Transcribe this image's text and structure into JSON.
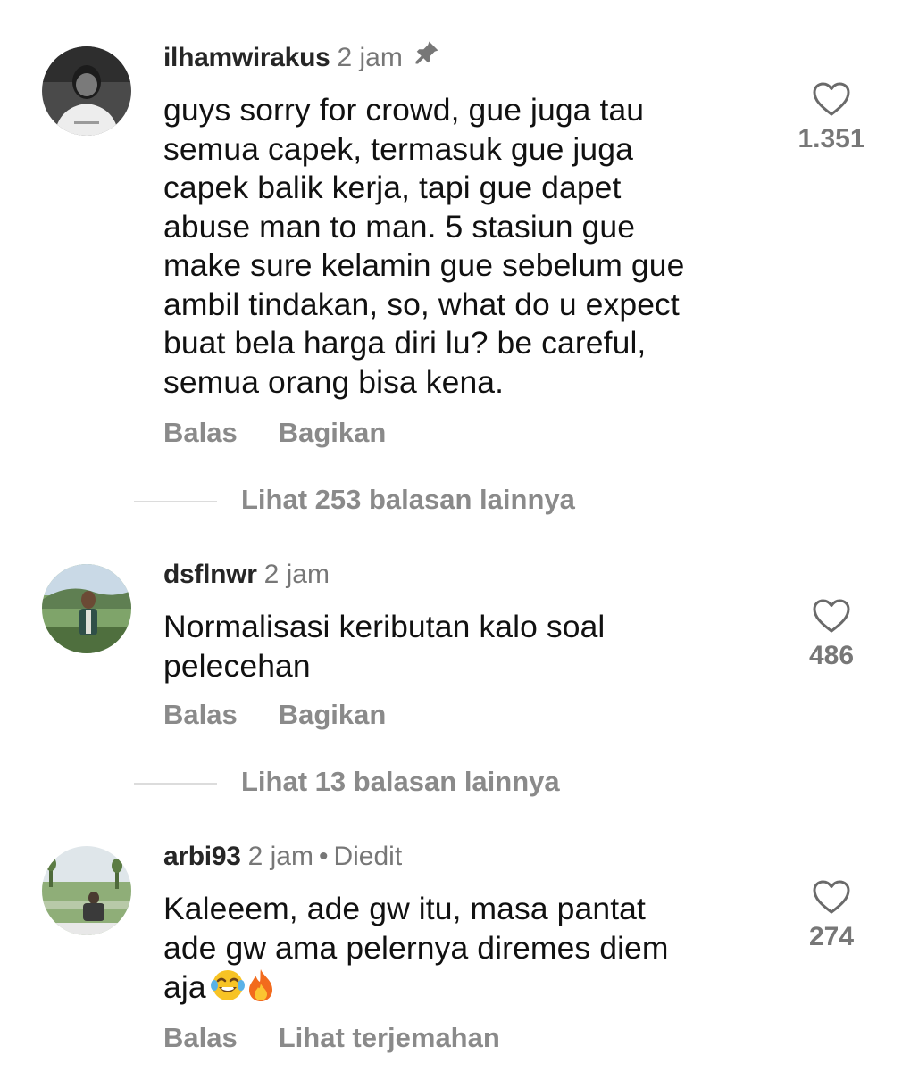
{
  "comments": [
    {
      "username": "ilhamwirakus",
      "time": "2 jam",
      "pinned": true,
      "text": "guys sorry for crowd, gue juga tau\nsemua capek, termasuk gue juga\ncapek balik kerja, tapi gue dapet\nabuse man to man. 5 stasiun gue\nmake sure kelamin gue sebelum gue\nambil tindakan, so, what do u expect\nbuat bela harga diri lu? be careful,\nsemua orang bisa kena.",
      "likes": "1.351",
      "reply_label": "Balas",
      "share_label": "Bagikan",
      "view_replies": "Lihat 253 balasan lainnya"
    },
    {
      "username": "dsflnwr",
      "time": "2 jam",
      "text": "Normalisasi keributan kalo soal\npelecehan",
      "likes": "486",
      "reply_label": "Balas",
      "share_label": "Bagikan",
      "view_replies": "Lihat 13 balasan lainnya"
    },
    {
      "username": "arbi93",
      "time": "2 jam",
      "separator": "•",
      "edited_label": "Diedit",
      "text": "Kaleeem, ade gw itu, masa pantat\nade gw ama pelernya diremes diem\naja",
      "emojis": [
        "face-with-tears-of-joy",
        "fire"
      ],
      "likes": "274",
      "reply_label": "Balas",
      "translate_label": "Lihat terjemahan"
    }
  ],
  "icons": {
    "like": "heart-outline-icon",
    "pin": "pin-icon"
  },
  "colors": {
    "text": "#111111",
    "secondary": "#777777",
    "action": "#8a8a8a",
    "divider": "#dcdcdc"
  }
}
